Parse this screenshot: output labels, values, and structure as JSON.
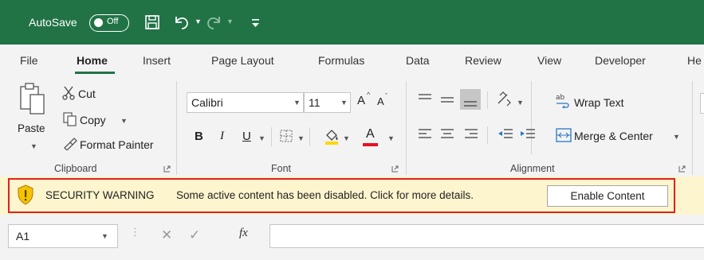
{
  "titlebar": {
    "autosave_label": "AutoSave",
    "autosave_state": "Off",
    "accent_color": "#217346"
  },
  "tabs": [
    {
      "label": "File"
    },
    {
      "label": "Home"
    },
    {
      "label": "Insert"
    },
    {
      "label": "Page Layout"
    },
    {
      "label": "Formulas"
    },
    {
      "label": "Data"
    },
    {
      "label": "Review"
    },
    {
      "label": "View"
    },
    {
      "label": "Developer"
    },
    {
      "label": "He"
    }
  ],
  "clipboard": {
    "paste": "Paste",
    "cut": "Cut",
    "copy": "Copy",
    "format_painter": "Format Painter",
    "group_label": "Clipboard"
  },
  "font": {
    "name": "Calibri",
    "size": "11",
    "bold": "B",
    "italic": "I",
    "underline": "U",
    "grow": "A",
    "shrink": "A",
    "font_color": "A",
    "font_color_hex": "#e81123",
    "group_label": "Font"
  },
  "alignment": {
    "wrap_text": "Wrap Text",
    "merge_center": "Merge & Center",
    "group_label": "Alignment"
  },
  "security": {
    "title": "SECURITY WARNING",
    "message": "Some active content has been disabled. Click for more details.",
    "button": "Enable Content",
    "bar_color": "#fdf5ce",
    "outline_color": "#e0201e"
  },
  "formula_bar": {
    "name_box": "A1",
    "fx": "fx"
  }
}
